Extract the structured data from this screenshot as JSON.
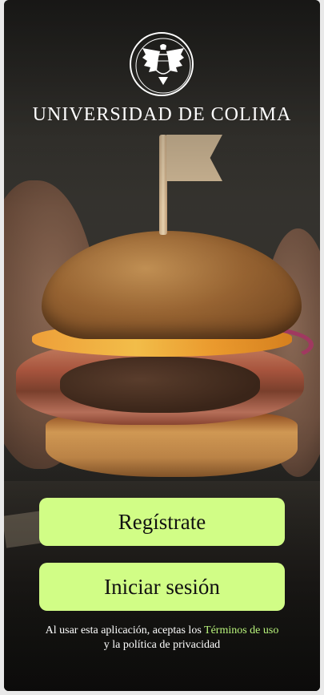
{
  "university": {
    "name": "UNIVERSIDAD DE COLIMA"
  },
  "buttons": {
    "register": "Regístrate",
    "login": "Iniciar sesión"
  },
  "terms": {
    "prefix": "Al usar esta aplicación, aceptas los",
    "link": "Términos de uso",
    "suffix": "y la política de privacidad"
  },
  "colors": {
    "button": "#d1fd86",
    "link": "#b9f47c"
  },
  "icons": {
    "seal": "university-seal-icon"
  }
}
